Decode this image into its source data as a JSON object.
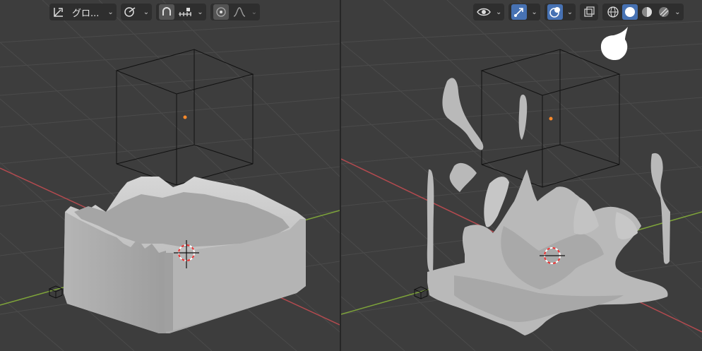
{
  "header": {
    "transform_pivot": {
      "icon": "transform-pivot-icon",
      "label": "グロ..."
    },
    "snap": {
      "icon": "snap-magnet-icon",
      "increment_icon": "snap-increment-icon"
    },
    "proportional_edit": {
      "icon": "proportional-edit-icon",
      "falloff_icon": "falloff-curve-icon"
    },
    "visibility": {
      "icon": "eye-icon"
    },
    "gizmo": {
      "icon": "gizmo-icon",
      "active": true
    },
    "overlays": {
      "icon": "overlays-icon",
      "active": true
    },
    "xray": {
      "icon": "xray-icon"
    },
    "shading_modes": [
      {
        "name": "wireframe",
        "icon": "wireframe-shading-icon",
        "active": false
      },
      {
        "name": "solid",
        "icon": "solid-shading-icon",
        "active": true
      },
      {
        "name": "material",
        "icon": "material-preview-icon",
        "active": false
      },
      {
        "name": "rendered",
        "icon": "rendered-shading-icon",
        "active": false
      }
    ]
  },
  "colors": {
    "viewport_bg": "#3d3d3d",
    "grid_line": "#4a4a4a",
    "x_axis": "#b34a4f",
    "y_axis": "#7ea43a",
    "fluid_mesh": "#bdbdbd",
    "accent": "#4772b3",
    "origin_dot": "#ff8a2a"
  },
  "callout": {
    "icon": "solid-shading-callout-icon"
  }
}
